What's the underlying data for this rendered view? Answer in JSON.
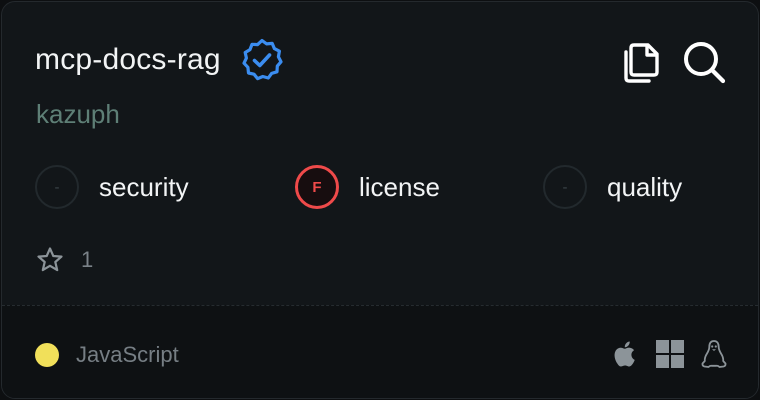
{
  "repo": {
    "name": "mcp-docs-rag",
    "author": "kazuph",
    "verified": true,
    "stars": "1"
  },
  "badges": [
    {
      "grade": "-",
      "label": "security",
      "status": "none"
    },
    {
      "grade": "F",
      "label": "license",
      "status": "fail"
    },
    {
      "grade": "-",
      "label": "quality",
      "status": "none"
    }
  ],
  "footer": {
    "language": "JavaScript",
    "language_color": "#f1e05a",
    "platforms": [
      "apple-icon",
      "windows-icon",
      "linux-icon"
    ]
  },
  "colors": {
    "verified": "#3b8df0",
    "fail": "#ef4a4a"
  }
}
